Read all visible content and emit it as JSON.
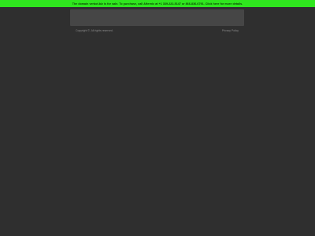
{
  "banner": {
    "text": "The domain verbot.biz is for sale. To purchase, call Afternic at +1 339-222-5147 or 866-836-6791. Click here for more details."
  },
  "footer": {
    "copyright": "Copyright ©. All rights reserved.",
    "privacy_link": "Privacy Policy"
  },
  "colors": {
    "page_background": "#2f2f2f",
    "banner_background": "#2fe61e",
    "banner_text": "#0b3b06",
    "panel_background": "#464646",
    "footer_text": "#8c8c8c"
  }
}
